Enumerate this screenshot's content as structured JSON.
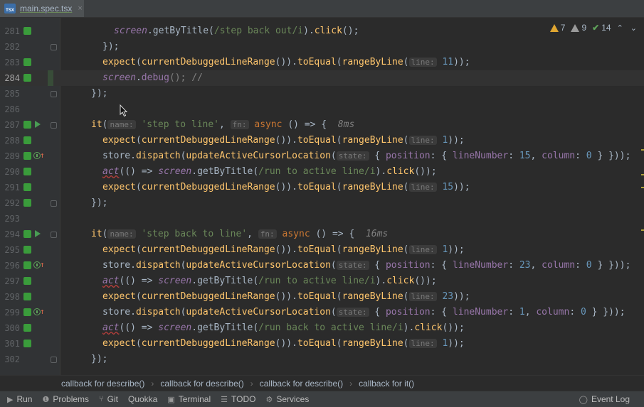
{
  "tab": {
    "filename": "main.spec.tsx",
    "icon": "TSX",
    "close": "×"
  },
  "inspection": {
    "warnings": "7",
    "weak_warnings": "9",
    "ok": "14",
    "up": "⌃",
    "down": "⌄"
  },
  "lines": [
    {
      "num": "281",
      "tokens": [
        {
          "t": "screen",
          "c": "glob"
        },
        {
          "t": ".getByTitle(",
          "c": ""
        },
        {
          "t": "/step back out/i",
          "c": "str"
        },
        {
          "t": ").",
          "c": ""
        },
        {
          "t": "click",
          "c": "fn"
        },
        {
          "t": "();",
          "c": ""
        }
      ]
    },
    {
      "num": "282",
      "tokens": [
        {
          "t": "});",
          "c": ""
        }
      ]
    },
    {
      "num": "283",
      "tokens": [
        {
          "t": "expect",
          "c": "fn"
        },
        {
          "t": "(",
          "c": ""
        },
        {
          "t": "currentDebuggedLineRange",
          "c": "fn"
        },
        {
          "t": "()).",
          "c": ""
        },
        {
          "t": "toEqual",
          "c": "fn"
        },
        {
          "t": "(",
          "c": ""
        },
        {
          "t": "rangeByLine",
          "c": "fn"
        },
        {
          "t": "(",
          "c": ""
        },
        {
          "t": "line:",
          "c": "hint"
        },
        {
          "t": " ",
          "c": ""
        },
        {
          "t": "11",
          "c": "num"
        },
        {
          "t": "));",
          "c": ""
        }
      ]
    },
    {
      "num": "284",
      "tokens": [
        {
          "t": "screen",
          "c": "glob"
        },
        {
          "t": ".",
          "c": ""
        },
        {
          "t": "debug",
          "c": "mem"
        },
        {
          "t": "(); //",
          "c": "com"
        }
      ]
    },
    {
      "num": "285",
      "tokens": [
        {
          "t": "});",
          "c": ""
        }
      ]
    },
    {
      "num": "286",
      "tokens": []
    },
    {
      "num": "287",
      "tokens": [
        {
          "t": "it",
          "c": "fn"
        },
        {
          "t": "(",
          "c": ""
        },
        {
          "t": "name:",
          "c": "hint"
        },
        {
          "t": " ",
          "c": ""
        },
        {
          "t": "'step to line'",
          "c": "str"
        },
        {
          "t": ", ",
          "c": ""
        },
        {
          "t": "fn:",
          "c": "hint"
        },
        {
          "t": " ",
          "c": ""
        },
        {
          "t": "async",
          "c": "kw"
        },
        {
          "t": " () => {  ",
          "c": ""
        },
        {
          "t": "8ms",
          "c": "time"
        }
      ]
    },
    {
      "num": "288",
      "tokens": [
        {
          "t": "expect",
          "c": "fn"
        },
        {
          "t": "(",
          "c": ""
        },
        {
          "t": "currentDebuggedLineRange",
          "c": "fn"
        },
        {
          "t": "()).",
          "c": ""
        },
        {
          "t": "toEqual",
          "c": "fn"
        },
        {
          "t": "(",
          "c": ""
        },
        {
          "t": "rangeByLine",
          "c": "fn"
        },
        {
          "t": "(",
          "c": ""
        },
        {
          "t": "line:",
          "c": "hint"
        },
        {
          "t": " ",
          "c": ""
        },
        {
          "t": "1",
          "c": "num"
        },
        {
          "t": "));",
          "c": ""
        }
      ]
    },
    {
      "num": "289",
      "tokens": [
        {
          "t": "store.",
          "c": ""
        },
        {
          "t": "dispatch",
          "c": "fn"
        },
        {
          "t": "(",
          "c": ""
        },
        {
          "t": "updateActiveCursorLocation",
          "c": "fn"
        },
        {
          "t": "(",
          "c": ""
        },
        {
          "t": "state:",
          "c": "hint"
        },
        {
          "t": " { ",
          "c": ""
        },
        {
          "t": "position",
          "c": "mem"
        },
        {
          "t": ": { ",
          "c": ""
        },
        {
          "t": "lineNumber",
          "c": "mem"
        },
        {
          "t": ": ",
          "c": ""
        },
        {
          "t": "15",
          "c": "num"
        },
        {
          "t": ", ",
          "c": ""
        },
        {
          "t": "column",
          "c": "mem"
        },
        {
          "t": ": ",
          "c": ""
        },
        {
          "t": "0",
          "c": "num"
        },
        {
          "t": " } }));",
          "c": ""
        }
      ]
    },
    {
      "num": "290",
      "tokens": [
        {
          "t": "act",
          "c": "warn"
        },
        {
          "t": "(() => ",
          "c": ""
        },
        {
          "t": "screen",
          "c": "glob"
        },
        {
          "t": ".getByTitle(",
          "c": ""
        },
        {
          "t": "/run to active line/i",
          "c": "str"
        },
        {
          "t": ").",
          "c": ""
        },
        {
          "t": "click",
          "c": "fn"
        },
        {
          "t": "());",
          "c": ""
        }
      ]
    },
    {
      "num": "291",
      "tokens": [
        {
          "t": "expect",
          "c": "fn"
        },
        {
          "t": "(",
          "c": ""
        },
        {
          "t": "currentDebuggedLineRange",
          "c": "fn"
        },
        {
          "t": "()).",
          "c": ""
        },
        {
          "t": "toEqual",
          "c": "fn"
        },
        {
          "t": "(",
          "c": ""
        },
        {
          "t": "rangeByLine",
          "c": "fn"
        },
        {
          "t": "(",
          "c": ""
        },
        {
          "t": "line:",
          "c": "hint"
        },
        {
          "t": " ",
          "c": ""
        },
        {
          "t": "15",
          "c": "num"
        },
        {
          "t": "));",
          "c": ""
        }
      ]
    },
    {
      "num": "292",
      "tokens": [
        {
          "t": "});",
          "c": ""
        }
      ]
    },
    {
      "num": "293",
      "tokens": []
    },
    {
      "num": "294",
      "tokens": [
        {
          "t": "it",
          "c": "fn"
        },
        {
          "t": "(",
          "c": ""
        },
        {
          "t": "name:",
          "c": "hint"
        },
        {
          "t": " ",
          "c": ""
        },
        {
          "t": "'step back to line'",
          "c": "str"
        },
        {
          "t": ", ",
          "c": ""
        },
        {
          "t": "fn:",
          "c": "hint"
        },
        {
          "t": " ",
          "c": ""
        },
        {
          "t": "async",
          "c": "kw"
        },
        {
          "t": " () => {  ",
          "c": ""
        },
        {
          "t": "16ms",
          "c": "time"
        }
      ]
    },
    {
      "num": "295",
      "tokens": [
        {
          "t": "expect",
          "c": "fn"
        },
        {
          "t": "(",
          "c": ""
        },
        {
          "t": "currentDebuggedLineRange",
          "c": "fn"
        },
        {
          "t": "()).",
          "c": ""
        },
        {
          "t": "toEqual",
          "c": "fn"
        },
        {
          "t": "(",
          "c": ""
        },
        {
          "t": "rangeByLine",
          "c": "fn"
        },
        {
          "t": "(",
          "c": ""
        },
        {
          "t": "line:",
          "c": "hint"
        },
        {
          "t": " ",
          "c": ""
        },
        {
          "t": "1",
          "c": "num"
        },
        {
          "t": "));",
          "c": ""
        }
      ]
    },
    {
      "num": "296",
      "tokens": [
        {
          "t": "store.",
          "c": ""
        },
        {
          "t": "dispatch",
          "c": "fn"
        },
        {
          "t": "(",
          "c": ""
        },
        {
          "t": "updateActiveCursorLocation",
          "c": "fn"
        },
        {
          "t": "(",
          "c": ""
        },
        {
          "t": "state:",
          "c": "hint"
        },
        {
          "t": " { ",
          "c": ""
        },
        {
          "t": "position",
          "c": "mem"
        },
        {
          "t": ": { ",
          "c": ""
        },
        {
          "t": "lineNumber",
          "c": "mem"
        },
        {
          "t": ": ",
          "c": ""
        },
        {
          "t": "23",
          "c": "num"
        },
        {
          "t": ", ",
          "c": ""
        },
        {
          "t": "column",
          "c": "mem"
        },
        {
          "t": ": ",
          "c": ""
        },
        {
          "t": "0",
          "c": "num"
        },
        {
          "t": " } }));",
          "c": ""
        }
      ]
    },
    {
      "num": "297",
      "tokens": [
        {
          "t": "act",
          "c": "warn"
        },
        {
          "t": "(() => ",
          "c": ""
        },
        {
          "t": "screen",
          "c": "glob"
        },
        {
          "t": ".getByTitle(",
          "c": ""
        },
        {
          "t": "/run to active line/i",
          "c": "str"
        },
        {
          "t": ").",
          "c": ""
        },
        {
          "t": "click",
          "c": "fn"
        },
        {
          "t": "());",
          "c": ""
        }
      ]
    },
    {
      "num": "298",
      "tokens": [
        {
          "t": "expect",
          "c": "fn"
        },
        {
          "t": "(",
          "c": ""
        },
        {
          "t": "currentDebuggedLineRange",
          "c": "fn"
        },
        {
          "t": "()).",
          "c": ""
        },
        {
          "t": "toEqual",
          "c": "fn"
        },
        {
          "t": "(",
          "c": ""
        },
        {
          "t": "rangeByLine",
          "c": "fn"
        },
        {
          "t": "(",
          "c": ""
        },
        {
          "t": "line:",
          "c": "hint"
        },
        {
          "t": " ",
          "c": ""
        },
        {
          "t": "23",
          "c": "num"
        },
        {
          "t": "));",
          "c": ""
        }
      ]
    },
    {
      "num": "299",
      "tokens": [
        {
          "t": "store.",
          "c": ""
        },
        {
          "t": "dispatch",
          "c": "fn"
        },
        {
          "t": "(",
          "c": ""
        },
        {
          "t": "updateActiveCursorLocation",
          "c": "fn"
        },
        {
          "t": "(",
          "c": ""
        },
        {
          "t": "state:",
          "c": "hint"
        },
        {
          "t": " { ",
          "c": ""
        },
        {
          "t": "position",
          "c": "mem"
        },
        {
          "t": ": { ",
          "c": ""
        },
        {
          "t": "lineNumber",
          "c": "mem"
        },
        {
          "t": ": ",
          "c": ""
        },
        {
          "t": "1",
          "c": "num"
        },
        {
          "t": ", ",
          "c": ""
        },
        {
          "t": "column",
          "c": "mem"
        },
        {
          "t": ": ",
          "c": ""
        },
        {
          "t": "0",
          "c": "num"
        },
        {
          "t": " } }));",
          "c": ""
        }
      ]
    },
    {
      "num": "300",
      "tokens": [
        {
          "t": "act",
          "c": "warn"
        },
        {
          "t": "(() => ",
          "c": ""
        },
        {
          "t": "screen",
          "c": "glob"
        },
        {
          "t": ".getByTitle(",
          "c": ""
        },
        {
          "t": "/run back to active line/i",
          "c": "str"
        },
        {
          "t": ").",
          "c": ""
        },
        {
          "t": "click",
          "c": "fn"
        },
        {
          "t": "());",
          "c": ""
        }
      ]
    },
    {
      "num": "301",
      "tokens": [
        {
          "t": "expect",
          "c": "fn"
        },
        {
          "t": "(",
          "c": ""
        },
        {
          "t": "currentDebuggedLineRange",
          "c": "fn"
        },
        {
          "t": "()).",
          "c": ""
        },
        {
          "t": "toEqual",
          "c": "fn"
        },
        {
          "t": "(",
          "c": ""
        },
        {
          "t": "rangeByLine",
          "c": "fn"
        },
        {
          "t": "(",
          "c": ""
        },
        {
          "t": "line:",
          "c": "hint"
        },
        {
          "t": " ",
          "c": ""
        },
        {
          "t": "1",
          "c": "num"
        },
        {
          "t": "));",
          "c": ""
        }
      ]
    },
    {
      "num": "302",
      "tokens": [
        {
          "t": "});",
          "c": ""
        }
      ]
    }
  ],
  "breadcrumbs": [
    "callback for describe()",
    "callback for describe()",
    "callback for describe()",
    "callback for it()"
  ],
  "toolwindows": [
    {
      "label": "Run",
      "icon": "run-icon"
    },
    {
      "label": "Problems",
      "icon": "problems-icon"
    },
    {
      "label": "Git",
      "icon": "git-icon"
    },
    {
      "label": "Quokka",
      "icon": ""
    },
    {
      "label": "Terminal",
      "icon": "terminal-icon"
    },
    {
      "label": "TODO",
      "icon": "todo-icon"
    },
    {
      "label": "Services",
      "icon": "services-icon"
    }
  ],
  "event_log": "Event Log",
  "colors": {
    "keyword": "#cc7832",
    "function": "#ffc66d",
    "string": "#6a8759",
    "number": "#6897bb",
    "global": "#9876aa",
    "breakpoint": "#3a9c3b"
  }
}
